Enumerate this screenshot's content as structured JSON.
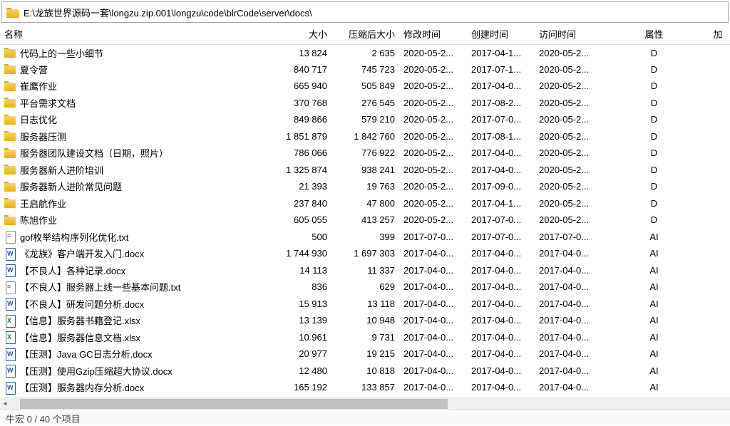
{
  "path": "E:\\龙族世界源码一套\\longzu.zip.001\\longzu\\code\\blrCode\\server\\docs\\",
  "columns": {
    "name": "名称",
    "size": "大小",
    "packed": "压缩后大小",
    "modified": "修改时间",
    "created": "创建时间",
    "accessed": "访问时间",
    "attrs": "属性",
    "extra": "加"
  },
  "status": "牛宏 0 / 40 个项目",
  "rows": [
    {
      "type": "folder",
      "name": "代码上的一些小细节",
      "size": "13 824",
      "packed": "2 635",
      "mod": "2020-05-2...",
      "cre": "2017-04-1...",
      "acc": "2020-05-2...",
      "attr": "D"
    },
    {
      "type": "folder",
      "name": "夏令营",
      "size": "840 717",
      "packed": "745 723",
      "mod": "2020-05-2...",
      "cre": "2017-07-1...",
      "acc": "2020-05-2...",
      "attr": "D"
    },
    {
      "type": "folder",
      "name": "崔鹰作业",
      "size": "665 940",
      "packed": "505 849",
      "mod": "2020-05-2...",
      "cre": "2017-04-0...",
      "acc": "2020-05-2...",
      "attr": "D"
    },
    {
      "type": "folder",
      "name": "平台需求文档",
      "size": "370 768",
      "packed": "276 545",
      "mod": "2020-05-2...",
      "cre": "2017-08-2...",
      "acc": "2020-05-2...",
      "attr": "D"
    },
    {
      "type": "folder",
      "name": "日志优化",
      "size": "849 866",
      "packed": "579 210",
      "mod": "2020-05-2...",
      "cre": "2017-07-0...",
      "acc": "2020-05-2...",
      "attr": "D"
    },
    {
      "type": "folder",
      "name": "服务器压测",
      "size": "1 851 879",
      "packed": "1 842 760",
      "mod": "2020-05-2...",
      "cre": "2017-08-1...",
      "acc": "2020-05-2...",
      "attr": "D"
    },
    {
      "type": "folder",
      "name": "服务器团队建设文档（日期，照片）",
      "size": "786 066",
      "packed": "776 922",
      "mod": "2020-05-2...",
      "cre": "2017-04-0...",
      "acc": "2020-05-2...",
      "attr": "D"
    },
    {
      "type": "folder",
      "name": "服务器新人进阶培训",
      "size": "1 325 874",
      "packed": "938 241",
      "mod": "2020-05-2...",
      "cre": "2017-04-0...",
      "acc": "2020-05-2...",
      "attr": "D"
    },
    {
      "type": "folder",
      "name": "服务器新人进阶常见问题",
      "size": "21 393",
      "packed": "19 763",
      "mod": "2020-05-2...",
      "cre": "2017-09-0...",
      "acc": "2020-05-2...",
      "attr": "D"
    },
    {
      "type": "folder",
      "name": "王启航作业",
      "size": "237 840",
      "packed": "47 800",
      "mod": "2020-05-2...",
      "cre": "2017-04-1...",
      "acc": "2020-05-2...",
      "attr": "D"
    },
    {
      "type": "folder",
      "name": "陈旭作业",
      "size": "605 055",
      "packed": "413 257",
      "mod": "2020-05-2...",
      "cre": "2017-07-0...",
      "acc": "2020-05-2...",
      "attr": "D"
    },
    {
      "type": "txt",
      "name": "gof枚举结构序列化优化.txt",
      "size": "500",
      "packed": "399",
      "mod": "2017-07-0...",
      "cre": "2017-07-0...",
      "acc": "2017-07-0...",
      "attr": "AI"
    },
    {
      "type": "docx",
      "name": "《龙族》客户端开发入门.docx",
      "size": "1 744 930",
      "packed": "1 697 303",
      "mod": "2017-04-0...",
      "cre": "2017-04-0...",
      "acc": "2017-04-0...",
      "attr": "AI"
    },
    {
      "type": "docx",
      "name": "【不良人】各种记录.docx",
      "size": "14 113",
      "packed": "11 337",
      "mod": "2017-04-0...",
      "cre": "2017-04-0...",
      "acc": "2017-04-0...",
      "attr": "AI"
    },
    {
      "type": "txt",
      "name": "【不良人】服务器上线一些基本问题.txt",
      "size": "836",
      "packed": "629",
      "mod": "2017-04-0...",
      "cre": "2017-04-0...",
      "acc": "2017-04-0...",
      "attr": "AI"
    },
    {
      "type": "docx",
      "name": "【不良人】研发问题分析.docx",
      "size": "15 913",
      "packed": "13 118",
      "mod": "2017-04-0...",
      "cre": "2017-04-0...",
      "acc": "2017-04-0...",
      "attr": "AI"
    },
    {
      "type": "xlsx",
      "name": "【信息】服务器书籍登记.xlsx",
      "size": "13 139",
      "packed": "10 948",
      "mod": "2017-04-0...",
      "cre": "2017-04-0...",
      "acc": "2017-04-0...",
      "attr": "AI"
    },
    {
      "type": "xlsx",
      "name": "【信息】服务器信息文档.xlsx",
      "size": "10 961",
      "packed": "9 731",
      "mod": "2017-04-0...",
      "cre": "2017-04-0...",
      "acc": "2017-04-0...",
      "attr": "AI"
    },
    {
      "type": "docx",
      "name": "【压测】Java GC日志分析.docx",
      "size": "20 977",
      "packed": "19 215",
      "mod": "2017-04-0...",
      "cre": "2017-04-0...",
      "acc": "2017-04-0...",
      "attr": "AI"
    },
    {
      "type": "docx",
      "name": "【压测】使用Gzip压缩超大协议.docx",
      "size": "12 480",
      "packed": "10 818",
      "mod": "2017-04-0...",
      "cre": "2017-04-0...",
      "acc": "2017-04-0...",
      "attr": "AI"
    },
    {
      "type": "docx",
      "name": "【压测】服务器内存分析.docx",
      "size": "165 192",
      "packed": "133 857",
      "mod": "2017-04-0...",
      "cre": "2017-04-0...",
      "acc": "2017-04-0...",
      "attr": "AI"
    }
  ]
}
